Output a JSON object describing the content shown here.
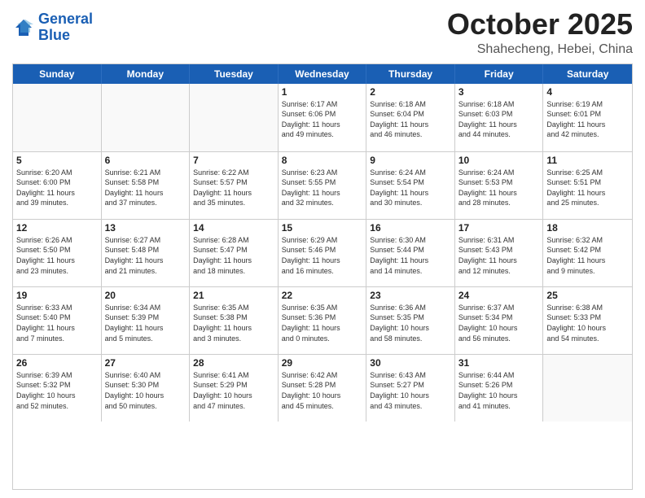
{
  "header": {
    "logo_line1": "General",
    "logo_line2": "Blue",
    "month": "October 2025",
    "location": "Shahecheng, Hebei, China"
  },
  "weekdays": [
    "Sunday",
    "Monday",
    "Tuesday",
    "Wednesday",
    "Thursday",
    "Friday",
    "Saturday"
  ],
  "weeks": [
    [
      {
        "day": "",
        "info": ""
      },
      {
        "day": "",
        "info": ""
      },
      {
        "day": "",
        "info": ""
      },
      {
        "day": "1",
        "info": "Sunrise: 6:17 AM\nSunset: 6:06 PM\nDaylight: 11 hours\nand 49 minutes."
      },
      {
        "day": "2",
        "info": "Sunrise: 6:18 AM\nSunset: 6:04 PM\nDaylight: 11 hours\nand 46 minutes."
      },
      {
        "day": "3",
        "info": "Sunrise: 6:18 AM\nSunset: 6:03 PM\nDaylight: 11 hours\nand 44 minutes."
      },
      {
        "day": "4",
        "info": "Sunrise: 6:19 AM\nSunset: 6:01 PM\nDaylight: 11 hours\nand 42 minutes."
      }
    ],
    [
      {
        "day": "5",
        "info": "Sunrise: 6:20 AM\nSunset: 6:00 PM\nDaylight: 11 hours\nand 39 minutes."
      },
      {
        "day": "6",
        "info": "Sunrise: 6:21 AM\nSunset: 5:58 PM\nDaylight: 11 hours\nand 37 minutes."
      },
      {
        "day": "7",
        "info": "Sunrise: 6:22 AM\nSunset: 5:57 PM\nDaylight: 11 hours\nand 35 minutes."
      },
      {
        "day": "8",
        "info": "Sunrise: 6:23 AM\nSunset: 5:55 PM\nDaylight: 11 hours\nand 32 minutes."
      },
      {
        "day": "9",
        "info": "Sunrise: 6:24 AM\nSunset: 5:54 PM\nDaylight: 11 hours\nand 30 minutes."
      },
      {
        "day": "10",
        "info": "Sunrise: 6:24 AM\nSunset: 5:53 PM\nDaylight: 11 hours\nand 28 minutes."
      },
      {
        "day": "11",
        "info": "Sunrise: 6:25 AM\nSunset: 5:51 PM\nDaylight: 11 hours\nand 25 minutes."
      }
    ],
    [
      {
        "day": "12",
        "info": "Sunrise: 6:26 AM\nSunset: 5:50 PM\nDaylight: 11 hours\nand 23 minutes."
      },
      {
        "day": "13",
        "info": "Sunrise: 6:27 AM\nSunset: 5:48 PM\nDaylight: 11 hours\nand 21 minutes."
      },
      {
        "day": "14",
        "info": "Sunrise: 6:28 AM\nSunset: 5:47 PM\nDaylight: 11 hours\nand 18 minutes."
      },
      {
        "day": "15",
        "info": "Sunrise: 6:29 AM\nSunset: 5:46 PM\nDaylight: 11 hours\nand 16 minutes."
      },
      {
        "day": "16",
        "info": "Sunrise: 6:30 AM\nSunset: 5:44 PM\nDaylight: 11 hours\nand 14 minutes."
      },
      {
        "day": "17",
        "info": "Sunrise: 6:31 AM\nSunset: 5:43 PM\nDaylight: 11 hours\nand 12 minutes."
      },
      {
        "day": "18",
        "info": "Sunrise: 6:32 AM\nSunset: 5:42 PM\nDaylight: 11 hours\nand 9 minutes."
      }
    ],
    [
      {
        "day": "19",
        "info": "Sunrise: 6:33 AM\nSunset: 5:40 PM\nDaylight: 11 hours\nand 7 minutes."
      },
      {
        "day": "20",
        "info": "Sunrise: 6:34 AM\nSunset: 5:39 PM\nDaylight: 11 hours\nand 5 minutes."
      },
      {
        "day": "21",
        "info": "Sunrise: 6:35 AM\nSunset: 5:38 PM\nDaylight: 11 hours\nand 3 minutes."
      },
      {
        "day": "22",
        "info": "Sunrise: 6:35 AM\nSunset: 5:36 PM\nDaylight: 11 hours\nand 0 minutes."
      },
      {
        "day": "23",
        "info": "Sunrise: 6:36 AM\nSunset: 5:35 PM\nDaylight: 10 hours\nand 58 minutes."
      },
      {
        "day": "24",
        "info": "Sunrise: 6:37 AM\nSunset: 5:34 PM\nDaylight: 10 hours\nand 56 minutes."
      },
      {
        "day": "25",
        "info": "Sunrise: 6:38 AM\nSunset: 5:33 PM\nDaylight: 10 hours\nand 54 minutes."
      }
    ],
    [
      {
        "day": "26",
        "info": "Sunrise: 6:39 AM\nSunset: 5:32 PM\nDaylight: 10 hours\nand 52 minutes."
      },
      {
        "day": "27",
        "info": "Sunrise: 6:40 AM\nSunset: 5:30 PM\nDaylight: 10 hours\nand 50 minutes."
      },
      {
        "day": "28",
        "info": "Sunrise: 6:41 AM\nSunset: 5:29 PM\nDaylight: 10 hours\nand 47 minutes."
      },
      {
        "day": "29",
        "info": "Sunrise: 6:42 AM\nSunset: 5:28 PM\nDaylight: 10 hours\nand 45 minutes."
      },
      {
        "day": "30",
        "info": "Sunrise: 6:43 AM\nSunset: 5:27 PM\nDaylight: 10 hours\nand 43 minutes."
      },
      {
        "day": "31",
        "info": "Sunrise: 6:44 AM\nSunset: 5:26 PM\nDaylight: 10 hours\nand 41 minutes."
      },
      {
        "day": "",
        "info": ""
      }
    ]
  ]
}
